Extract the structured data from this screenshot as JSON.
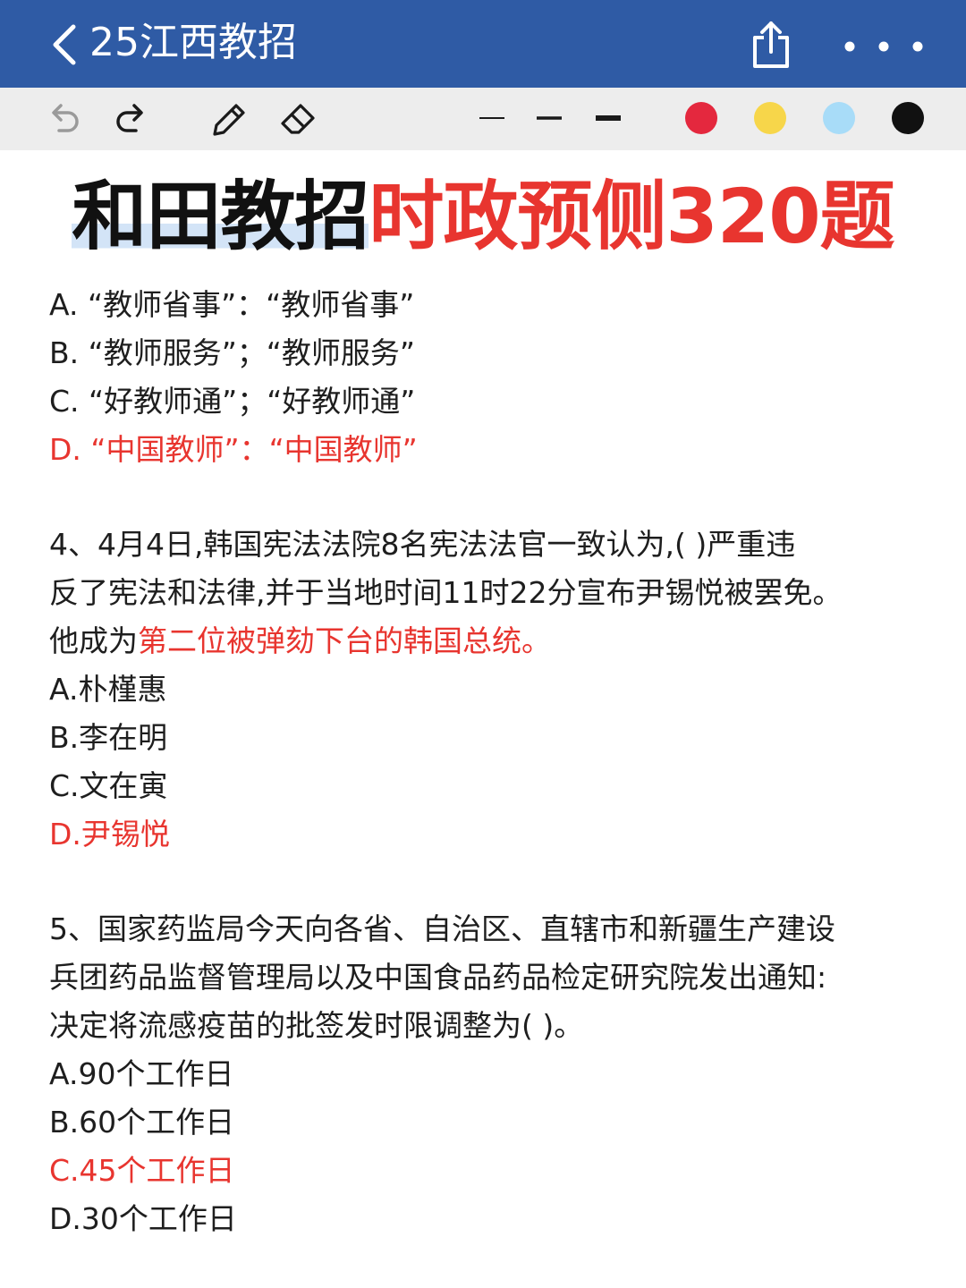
{
  "header": {
    "title": "25江西教招"
  },
  "toolbar": {
    "pen_colors": [
      "#e4283e",
      "#f7d64a",
      "#a8dcf8",
      "#111111"
    ],
    "highlight_color": "#d3e4f7",
    "answer_color": "#e8352f"
  },
  "headline": {
    "part1": "和田教招",
    "part2": "时政预侧320题"
  },
  "q3_options": {
    "a": "A. “教师省事”：“教师省事”",
    "b": "B. “教师服务”；“教师服务”",
    "c": "C. “好教师通”；“好教师通”",
    "d": "D. “中国教师”：“中国教师”"
  },
  "q4": {
    "line1": "4、4月4日,韩国宪法法院8名宪法法官一致认为,(     )严重违",
    "line2": "反了宪法和法律,并于当地时间11时22分宣布尹锡悦被罢免。",
    "line3_prefix": "他成为",
    "line3_highlight": "第二位被弹劾下台的韩国总统。",
    "options": {
      "a": "A.朴槿惠",
      "b": "B.李在明",
      "c": "C.文在寅",
      "d": "D.尹锡悦"
    }
  },
  "q5": {
    "line1": "5、国家药监局今天向各省、自治区、直辖市和新疆生产建设",
    "line2": "兵团药品监督管理局以及中国食品药品检定研究院发出通知:",
    "line3": "决定将流感疫苗的批签发时限调整为(     )。",
    "options": {
      "a": "A.90个工作日",
      "b": "B.60个工作日",
      "c": "C.45个工作日",
      "d": "D.30个工作日"
    }
  }
}
